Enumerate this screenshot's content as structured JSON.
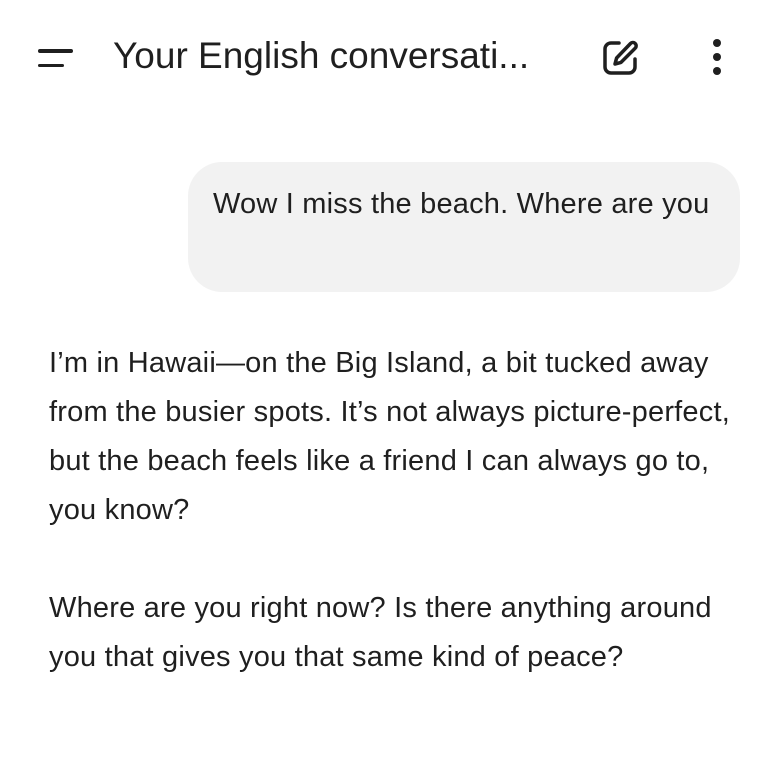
{
  "header": {
    "title": "Your English conversati...",
    "menu_icon": "menu-icon",
    "edit_icon": "edit-icon",
    "more_icon": "more-vertical-icon"
  },
  "messages": {
    "user": {
      "text": "Wow I miss the beach. Where are you"
    },
    "assistant": {
      "paragraphs": [
        "I’m in Hawaii—on the Big Island, a bit tucked away from the busier spots. It’s not always picture-perfect, but the beach feels like a friend I can always go to, you know?",
        "Where are you right now? Is there anything around you that gives you that same kind of peace?"
      ]
    }
  },
  "colors": {
    "bubble_bg": "#f2f2f2",
    "text": "#1f1f1f",
    "background": "#ffffff"
  }
}
